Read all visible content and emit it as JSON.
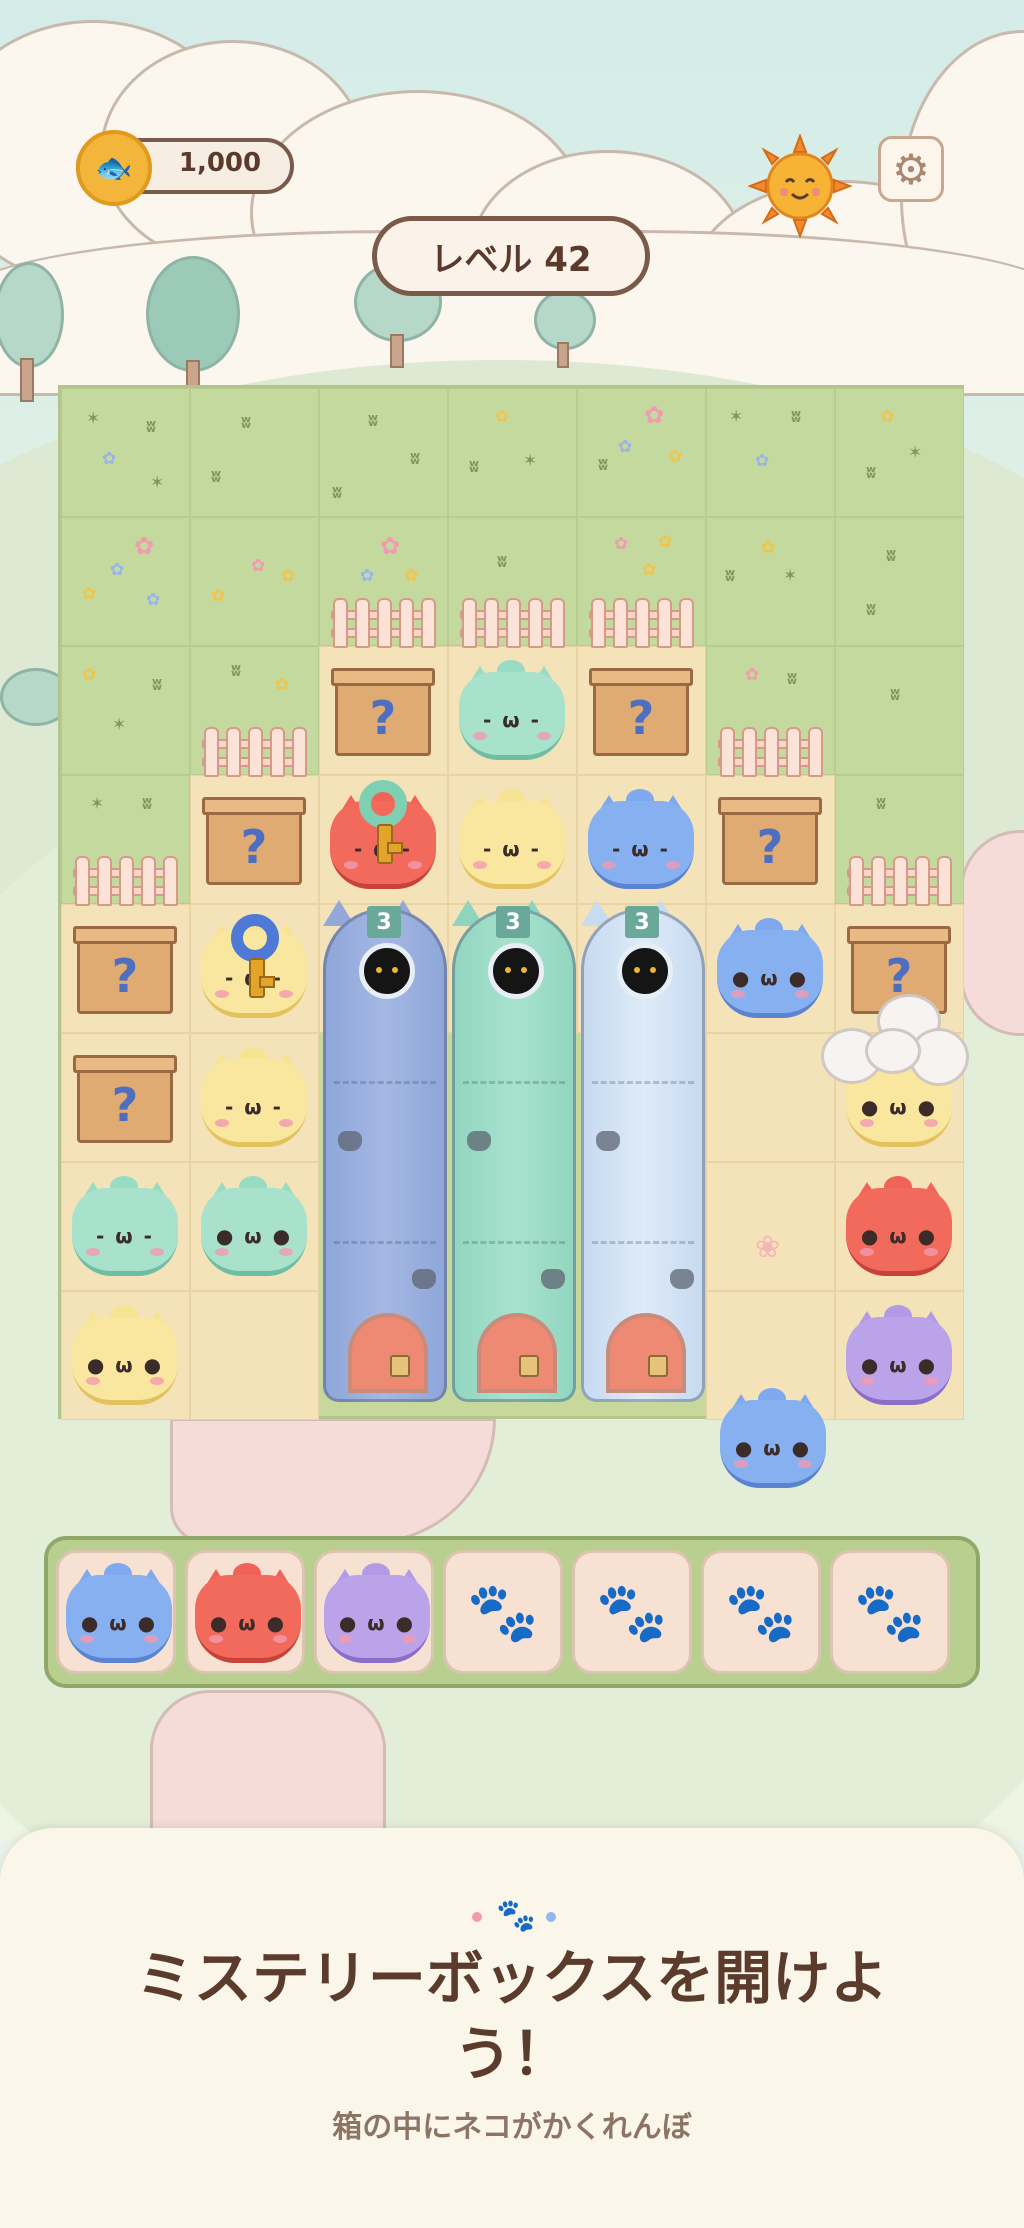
{
  "hud": {
    "coins": "1,000",
    "level_label": "レベル 42",
    "sun_icon": "sun-icon",
    "settings_icon": "gear-icon"
  },
  "board": {
    "rows": 8,
    "cols": 7,
    "tube_counters": [
      "3",
      "3",
      "3"
    ],
    "tube_colors": [
      "blue",
      "green",
      "light-blue"
    ],
    "box_mark": "?"
  },
  "tray": {
    "slots_total": 7,
    "filled": [
      "blue",
      "red",
      "purple"
    ],
    "empty_icon": "paw-icon"
  },
  "promo": {
    "headline": "ミステリーボックスを開けよう！",
    "subtitle": "箱の中にネコがかくれんぼ"
  },
  "colors": {
    "blue": "#7ea9ee",
    "green": "#98dcc4",
    "yellow": "#f7e493",
    "red": "#f06356",
    "purple": "#b39ae5",
    "light-blue": "#d2e4f6",
    "accent_brown": "#5b3b2c"
  }
}
